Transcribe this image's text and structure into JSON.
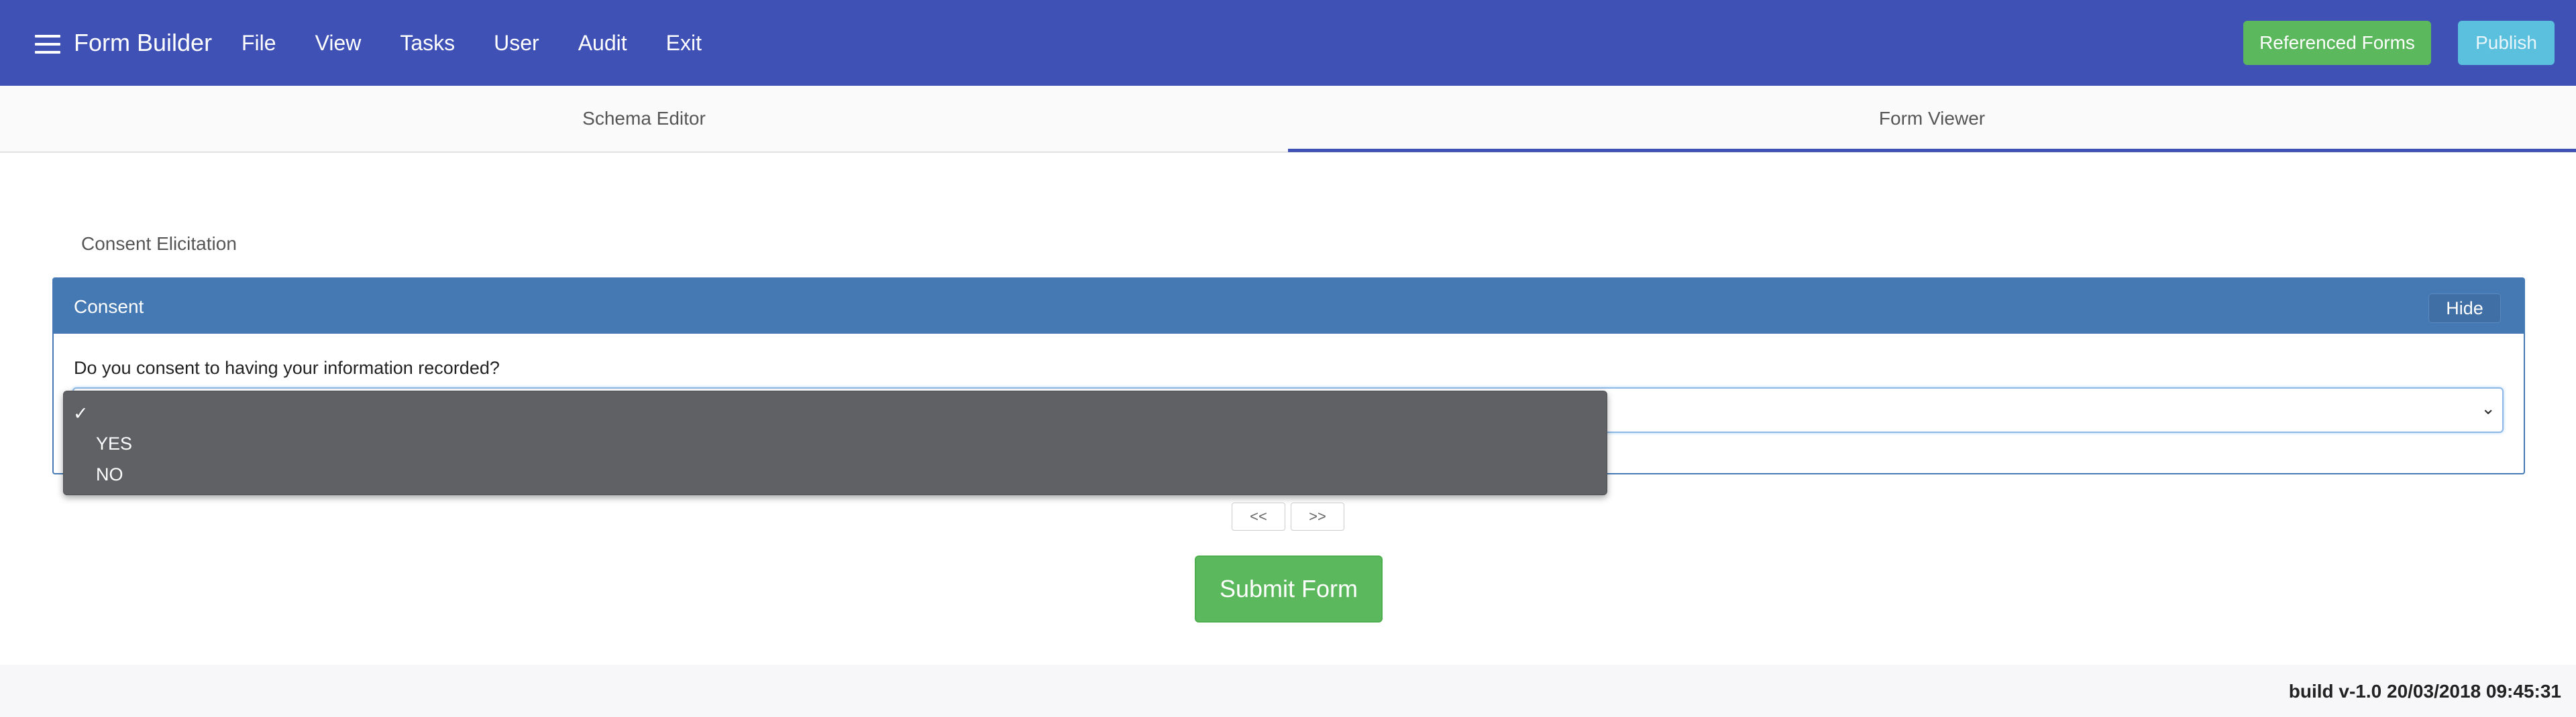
{
  "navbar": {
    "title": "Form Builder",
    "menu": [
      "File",
      "View",
      "Tasks",
      "User",
      "Audit",
      "Exit"
    ],
    "referenced_forms_label": "Referenced Forms",
    "publish_label": "Publish",
    "color": "#3f51b5"
  },
  "tabs": {
    "items": [
      "Schema Editor",
      "Form Viewer"
    ],
    "active": "Form Viewer"
  },
  "form": {
    "title": "Consent Elicitation",
    "panel": {
      "title": "Consent",
      "hide_label": "Hide",
      "question": "Do you consent to having your information recorded?",
      "select": {
        "selected_value": "",
        "options": [
          "",
          "YES",
          "NO"
        ]
      }
    },
    "pager": {
      "prev": "<<",
      "next": ">>"
    },
    "submit_label": "Submit Form"
  },
  "footer": {
    "build": "build v-1.0 20/03/2018 09:45:31"
  },
  "colors": {
    "panel_header": "#4479b4",
    "success": "#5cb85c",
    "info": "#5bc0de"
  }
}
